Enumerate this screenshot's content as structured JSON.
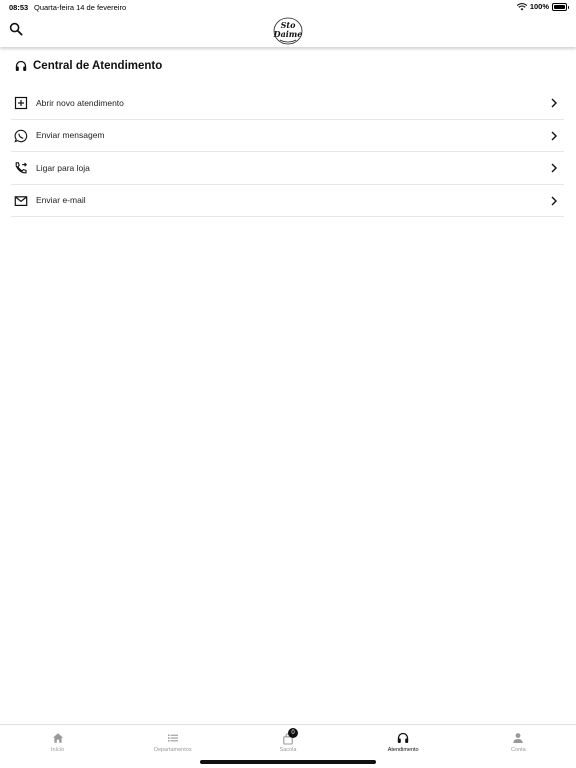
{
  "status_bar": {
    "time": "08:53",
    "date": "Quarta-feira 14 de fevereiro",
    "battery": "100%"
  },
  "header": {
    "search_icon": "search-icon",
    "logo_text_top": "Sto",
    "logo_text_bottom": "Daime"
  },
  "section": {
    "icon": "headphones-icon",
    "title": "Central de Atendimento"
  },
  "menu": {
    "items": [
      {
        "icon": "plus-square-icon",
        "label": "Abrir novo atendimento"
      },
      {
        "icon": "whatsapp-icon",
        "label": "Enviar mensagem"
      },
      {
        "icon": "phone-forward-icon",
        "label": "Ligar para loja"
      },
      {
        "icon": "envelope-icon",
        "label": "Enviar e-mail"
      }
    ]
  },
  "tabs": [
    {
      "icon": "home-icon",
      "label": "Início",
      "active": false
    },
    {
      "icon": "list-icon",
      "label": "Departamentos",
      "active": false
    },
    {
      "icon": "bag-icon",
      "label": "Sacola",
      "active": false,
      "badge": "0"
    },
    {
      "icon": "headphones-icon",
      "label": "Atendimento",
      "active": true
    },
    {
      "icon": "person-icon",
      "label": "Conta",
      "active": false
    }
  ],
  "colors": {
    "text": "#111111",
    "inactive_tab": "#999999",
    "divider": "#e6e6e6"
  }
}
